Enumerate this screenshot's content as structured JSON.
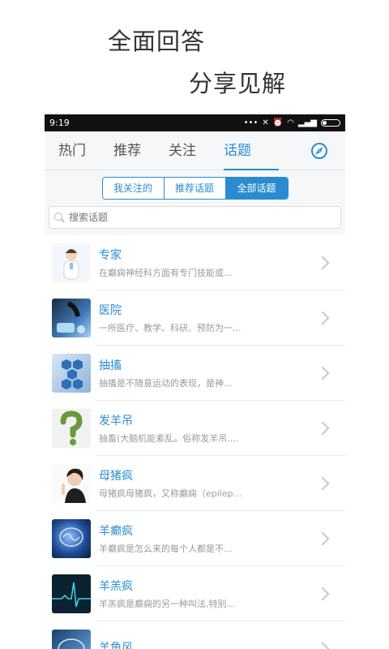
{
  "promo": {
    "line1": "全面回答",
    "line2": "分享见解"
  },
  "status_bar": {
    "time": "9:19",
    "icons": [
      "more-icon",
      "mute-icon",
      "alarm-icon",
      "wifi-icon",
      "signal-icon",
      "battery-icon"
    ]
  },
  "tabs": [
    {
      "label": "热门",
      "active": false
    },
    {
      "label": "推荐",
      "active": false
    },
    {
      "label": "关注",
      "active": false
    },
    {
      "label": "话题",
      "active": true
    }
  ],
  "segments": [
    {
      "label": "我关注的",
      "active": false
    },
    {
      "label": "推荐话题",
      "active": false
    },
    {
      "label": "全部话题",
      "active": true
    }
  ],
  "search": {
    "placeholder": "搜索话题"
  },
  "topics": [
    {
      "title": "专家",
      "desc": "在癫痫神经科方面有专门技能或...",
      "icon": "nurse-image"
    },
    {
      "title": "医院",
      "desc": "一所医疗、教学、科研、预防为一...",
      "icon": "lab-image"
    },
    {
      "title": "抽搐",
      "desc": "抽搐是不随意运动的表现，是神...",
      "icon": "medical-network-image"
    },
    {
      "title": "发羊吊",
      "desc": "抽畜(大脑机能紊乱。俗称发羊吊....",
      "icon": "moss-question-image"
    },
    {
      "title": "母猪疯",
      "desc": "母猪疯母猪疯，又称癫痫（epilep...",
      "icon": "woman-thinking-image"
    },
    {
      "title": "羊癫疯",
      "desc": "羊癫疯是怎么来的每个人都是不...",
      "icon": "brain-image"
    },
    {
      "title": "羊羔疯",
      "desc": "羊羔疯是癫痫的另一种叫法,特别...",
      "icon": "ecg-image"
    },
    {
      "title": "羊角风",
      "desc": "",
      "icon": "brain-scan-image"
    }
  ],
  "colors": {
    "accent": "#2a8cd0",
    "statusbar": "#111111"
  }
}
